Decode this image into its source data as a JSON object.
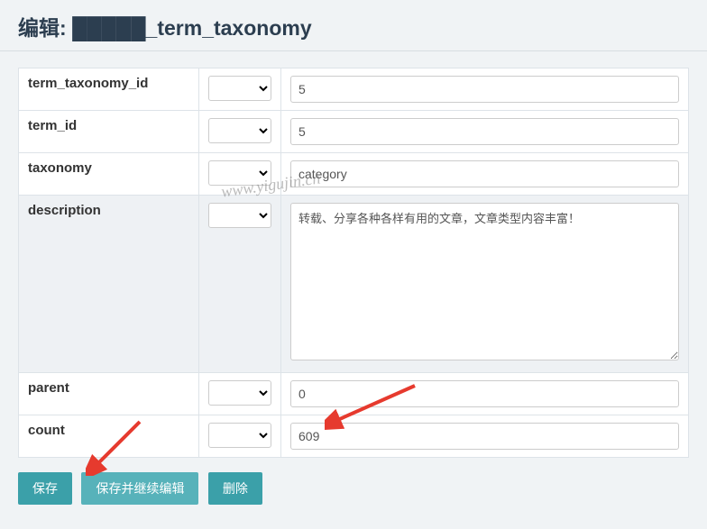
{
  "header": {
    "title_prefix": "编辑: ",
    "title_obscured": "█████",
    "title_suffix": "_term_taxonomy"
  },
  "fields": {
    "term_taxonomy_id": {
      "label": "term_taxonomy_id",
      "value": "5"
    },
    "term_id": {
      "label": "term_id",
      "value": "5"
    },
    "taxonomy": {
      "label": "taxonomy",
      "value": "category"
    },
    "description": {
      "label": "description",
      "value": "转载、分享各种各样有用的文章，文章类型内容丰富！"
    },
    "parent": {
      "label": "parent",
      "value": "0"
    },
    "count": {
      "label": "count",
      "value": "609"
    }
  },
  "buttons": {
    "save": "保存",
    "save_continue": "保存并继续编辑",
    "delete": "删除"
  },
  "watermark": "www.yigujin.cn"
}
